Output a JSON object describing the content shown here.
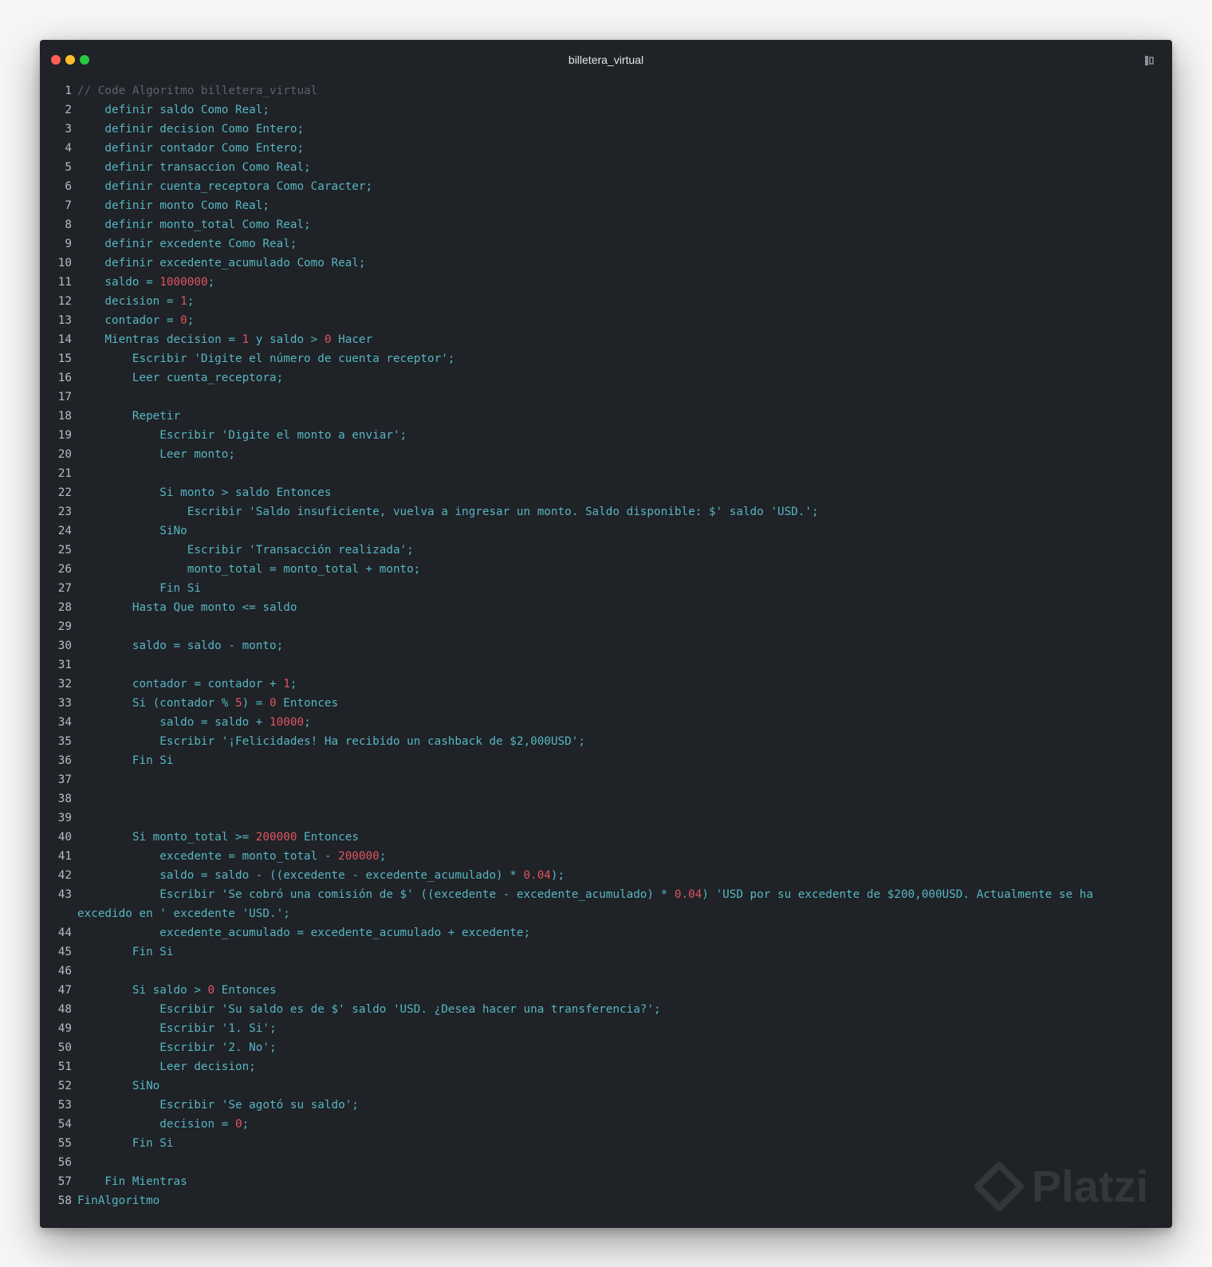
{
  "window": {
    "title": "billetera_virtual",
    "traffic_lights": [
      "#ff5f56",
      "#ffbd2e",
      "#27c93f"
    ]
  },
  "colors": {
    "background": "#1f2227",
    "keyword": "#56b6c2",
    "comment": "#5c6370",
    "number": "#e05561",
    "line_number": "#b7bcc3"
  },
  "icons": {
    "copy": "copy-icon"
  },
  "watermark": {
    "text": "Platzi"
  },
  "lines": [
    {
      "n": "1",
      "parts": [
        {
          "c": "cmt",
          "t": "// Code Algoritmo billetera_virtual"
        }
      ]
    },
    {
      "n": "2",
      "parts": [
        {
          "t": "    definir saldo Como Real;"
        }
      ]
    },
    {
      "n": "3",
      "parts": [
        {
          "t": "    definir decision Como Entero;"
        }
      ]
    },
    {
      "n": "4",
      "parts": [
        {
          "t": "    definir contador Como Entero;"
        }
      ]
    },
    {
      "n": "5",
      "parts": [
        {
          "t": "    definir transaccion Como Real;"
        }
      ]
    },
    {
      "n": "6",
      "parts": [
        {
          "t": "    definir cuenta_receptora Como Caracter;"
        }
      ]
    },
    {
      "n": "7",
      "parts": [
        {
          "t": "    definir monto Como Real;"
        }
      ]
    },
    {
      "n": "8",
      "parts": [
        {
          "t": "    definir monto_total Como Real;"
        }
      ]
    },
    {
      "n": "9",
      "parts": [
        {
          "t": "    definir excedente Como Real;"
        }
      ]
    },
    {
      "n": "10",
      "parts": [
        {
          "t": "    definir excedente_acumulado Como Real;"
        }
      ]
    },
    {
      "n": "11",
      "parts": [
        {
          "t": "    saldo = "
        },
        {
          "c": "num",
          "t": "1000000"
        },
        {
          "t": ";"
        }
      ]
    },
    {
      "n": "12",
      "parts": [
        {
          "t": "    decision = "
        },
        {
          "c": "num",
          "t": "1"
        },
        {
          "t": ";"
        }
      ]
    },
    {
      "n": "13",
      "parts": [
        {
          "t": "    contador = "
        },
        {
          "c": "num",
          "t": "0"
        },
        {
          "t": ";"
        }
      ]
    },
    {
      "n": "14",
      "parts": [
        {
          "t": "    Mientras decision = "
        },
        {
          "c": "num",
          "t": "1"
        },
        {
          "t": " y saldo > "
        },
        {
          "c": "num",
          "t": "0"
        },
        {
          "t": " Hacer"
        }
      ]
    },
    {
      "n": "15",
      "parts": [
        {
          "t": "        Escribir 'Digite el número de cuenta receptor';"
        }
      ]
    },
    {
      "n": "16",
      "parts": [
        {
          "t": "        Leer cuenta_receptora;"
        }
      ]
    },
    {
      "n": "17",
      "parts": [
        {
          "t": ""
        }
      ]
    },
    {
      "n": "18",
      "parts": [
        {
          "t": "        Repetir"
        }
      ]
    },
    {
      "n": "19",
      "parts": [
        {
          "t": "            Escribir 'Digite el monto a enviar';"
        }
      ]
    },
    {
      "n": "20",
      "parts": [
        {
          "t": "            Leer monto;"
        }
      ]
    },
    {
      "n": "21",
      "parts": [
        {
          "t": ""
        }
      ]
    },
    {
      "n": "22",
      "parts": [
        {
          "t": "            Si monto > saldo Entonces"
        }
      ]
    },
    {
      "n": "23",
      "parts": [
        {
          "t": "                Escribir 'Saldo insuficiente, vuelva a ingresar un monto. Saldo disponible: $' saldo 'USD.';"
        }
      ]
    },
    {
      "n": "24",
      "parts": [
        {
          "t": "            SiNo"
        }
      ]
    },
    {
      "n": "25",
      "parts": [
        {
          "t": "                Escribir 'Transacción realizada';"
        }
      ]
    },
    {
      "n": "26",
      "parts": [
        {
          "t": "                monto_total = monto_total + monto;"
        }
      ]
    },
    {
      "n": "27",
      "parts": [
        {
          "t": "            Fin Si"
        }
      ]
    },
    {
      "n": "28",
      "parts": [
        {
          "t": "        Hasta Que monto <= saldo"
        }
      ]
    },
    {
      "n": "29",
      "parts": [
        {
          "t": ""
        }
      ]
    },
    {
      "n": "30",
      "parts": [
        {
          "t": "        saldo = saldo - monto;"
        }
      ]
    },
    {
      "n": "31",
      "parts": [
        {
          "t": ""
        }
      ]
    },
    {
      "n": "32",
      "parts": [
        {
          "t": "        contador = contador + "
        },
        {
          "c": "num",
          "t": "1"
        },
        {
          "t": ";"
        }
      ]
    },
    {
      "n": "33",
      "parts": [
        {
          "t": "        Si (contador % "
        },
        {
          "c": "num",
          "t": "5"
        },
        {
          "t": ") = "
        },
        {
          "c": "num",
          "t": "0"
        },
        {
          "t": " Entonces"
        }
      ]
    },
    {
      "n": "34",
      "parts": [
        {
          "t": "            saldo = saldo + "
        },
        {
          "c": "num",
          "t": "10000"
        },
        {
          "t": ";"
        }
      ]
    },
    {
      "n": "35",
      "parts": [
        {
          "t": "            Escribir '¡Felicidades! Ha recibido un cashback de $2,000USD';"
        }
      ]
    },
    {
      "n": "36",
      "parts": [
        {
          "t": "        Fin Si"
        }
      ]
    },
    {
      "n": "37",
      "parts": [
        {
          "t": ""
        }
      ]
    },
    {
      "n": "38",
      "parts": [
        {
          "t": ""
        }
      ]
    },
    {
      "n": "39",
      "parts": [
        {
          "t": ""
        }
      ]
    },
    {
      "n": "40",
      "parts": [
        {
          "t": "        Si monto_total >= "
        },
        {
          "c": "num",
          "t": "200000"
        },
        {
          "t": " Entonces"
        }
      ]
    },
    {
      "n": "41",
      "parts": [
        {
          "t": "            excedente = monto_total - "
        },
        {
          "c": "num",
          "t": "200000"
        },
        {
          "t": ";"
        }
      ]
    },
    {
      "n": "42",
      "parts": [
        {
          "t": "            saldo = saldo - ((excedente - excedente_acumulado) * "
        },
        {
          "c": "num",
          "t": "0.04"
        },
        {
          "t": ");"
        }
      ]
    },
    {
      "n": "43",
      "tall": true,
      "parts": [
        {
          "t": "            Escribir 'Se cobró una comisión de $' ((excedente - excedente_acumulado) * "
        },
        {
          "c": "num",
          "t": "0.04"
        },
        {
          "t": ") 'USD por su excedente de $200,000USD. Actualmente se ha\nexcedido en ' excedente 'USD.';"
        }
      ]
    },
    {
      "n": "44",
      "parts": [
        {
          "t": "            excedente_acumulado = excedente_acumulado + excedente;"
        }
      ]
    },
    {
      "n": "45",
      "parts": [
        {
          "t": "        Fin Si"
        }
      ]
    },
    {
      "n": "46",
      "parts": [
        {
          "t": ""
        }
      ]
    },
    {
      "n": "47",
      "parts": [
        {
          "t": "        Si saldo > "
        },
        {
          "c": "num",
          "t": "0"
        },
        {
          "t": " Entonces"
        }
      ]
    },
    {
      "n": "48",
      "parts": [
        {
          "t": "            Escribir 'Su saldo es de $' saldo 'USD. ¿Desea hacer una transferencia?';"
        }
      ]
    },
    {
      "n": "49",
      "parts": [
        {
          "t": "            Escribir '1. Si';"
        }
      ]
    },
    {
      "n": "50",
      "parts": [
        {
          "t": "            Escribir '2. No';"
        }
      ]
    },
    {
      "n": "51",
      "parts": [
        {
          "t": "            Leer decision;"
        }
      ]
    },
    {
      "n": "52",
      "parts": [
        {
          "t": "        SiNo"
        }
      ]
    },
    {
      "n": "53",
      "parts": [
        {
          "t": "            Escribir 'Se agotó su saldo';"
        }
      ]
    },
    {
      "n": "54",
      "parts": [
        {
          "t": "            decision = "
        },
        {
          "c": "num",
          "t": "0"
        },
        {
          "t": ";"
        }
      ]
    },
    {
      "n": "55",
      "parts": [
        {
          "t": "        Fin Si"
        }
      ]
    },
    {
      "n": "56",
      "parts": [
        {
          "t": ""
        }
      ]
    },
    {
      "n": "57",
      "parts": [
        {
          "t": "    Fin Mientras"
        }
      ]
    },
    {
      "n": "58",
      "parts": [
        {
          "t": "FinAlgoritmo"
        }
      ]
    }
  ]
}
